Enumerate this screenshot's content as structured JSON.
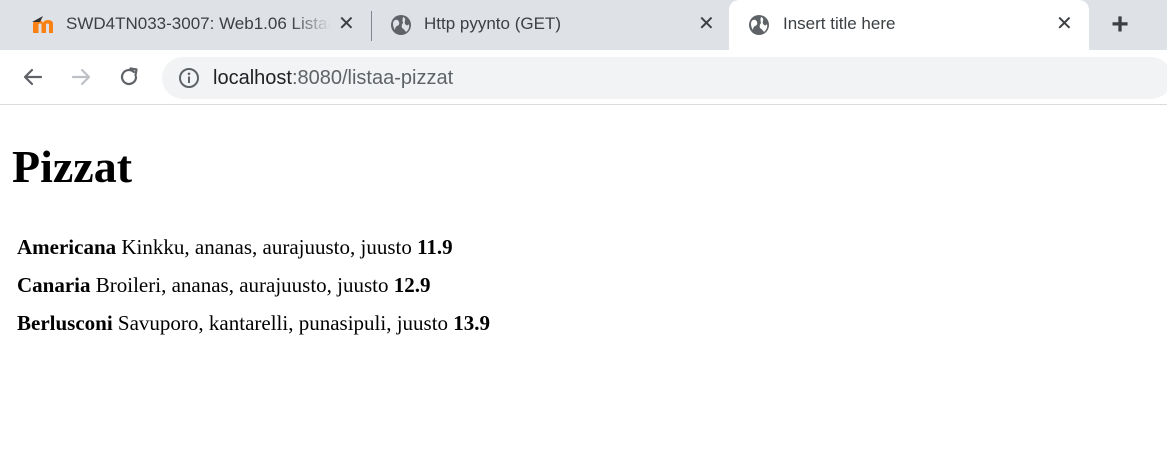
{
  "browser": {
    "tabs": [
      {
        "title": "SWD4TN033-3007: Web1.06 Listaa",
        "icon": "moodle-icon",
        "active": false
      },
      {
        "title": "Http pyynto (GET)",
        "icon": "globe-icon",
        "active": false
      },
      {
        "title": "Insert title here",
        "icon": "globe-icon",
        "active": true
      }
    ],
    "close_glyph": "✕",
    "new_tab_glyph": "+",
    "address": {
      "host": "localhost",
      "rest": ":8080/listaa-pizzat"
    }
  },
  "page": {
    "heading": "Pizzat",
    "pizzas": [
      {
        "name": "Americana",
        "ingredients": "Kinkku, ananas, aurajuusto, juusto",
        "price": "11.9"
      },
      {
        "name": "Canaria",
        "ingredients": "Broileri, ananas, aurajuusto, juusto",
        "price": "12.9"
      },
      {
        "name": "Berlusconi",
        "ingredients": "Savuporo, kantarelli, punasipuli, juusto",
        "price": "13.9"
      }
    ]
  },
  "colors": {
    "tabstrip_bg": "#dee1e6",
    "omnibox_bg": "#f1f3f4",
    "moodle_orange": "#f98012"
  }
}
